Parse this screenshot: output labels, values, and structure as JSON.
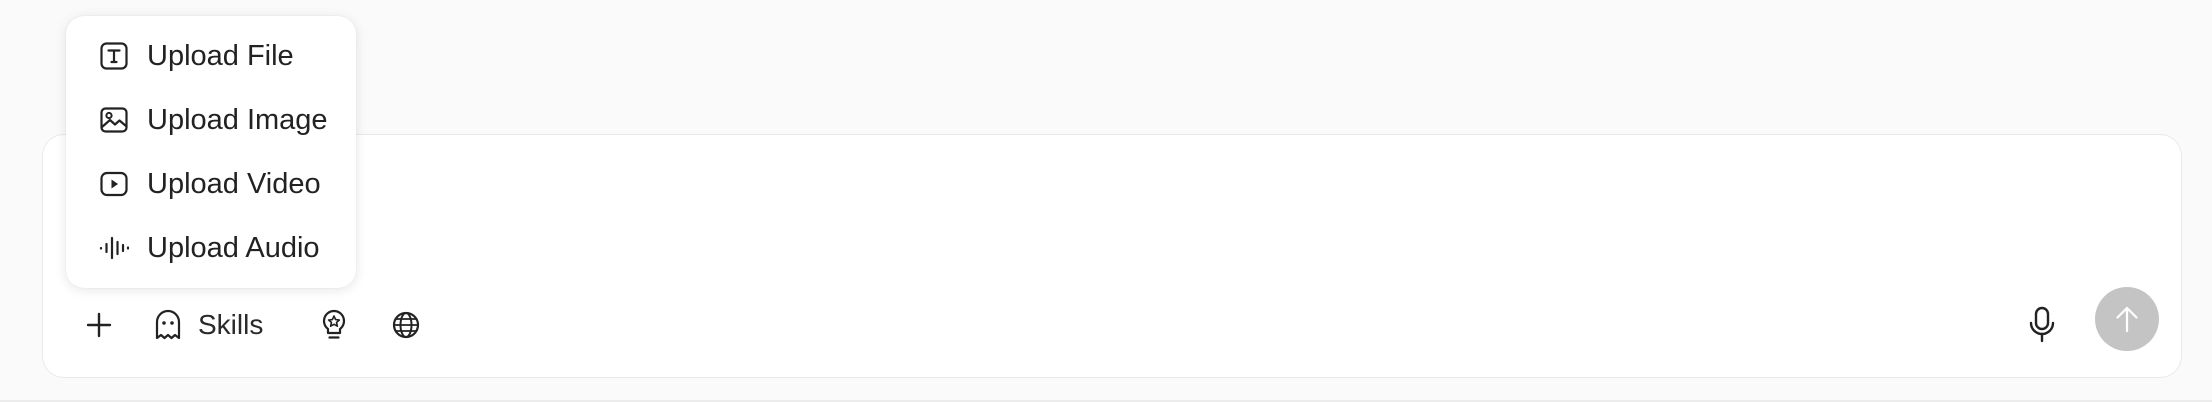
{
  "upload_menu": {
    "items": [
      {
        "label": "Upload File",
        "icon": "text-file-icon"
      },
      {
        "label": "Upload Image",
        "icon": "image-icon"
      },
      {
        "label": "Upload Video",
        "icon": "video-icon"
      },
      {
        "label": "Upload Audio",
        "icon": "audio-waveform-icon"
      }
    ]
  },
  "toolbar": {
    "skills_label": "Skills",
    "icons": [
      "plus-icon",
      "ghost-icon",
      "lightbulb-icon",
      "globe-icon",
      "microphone-icon",
      "arrow-up-icon"
    ]
  },
  "colors": {
    "send_button_disabled": "#c4c4c4",
    "composer_border": "#e9e9e9",
    "page_background": "#fafafa"
  }
}
